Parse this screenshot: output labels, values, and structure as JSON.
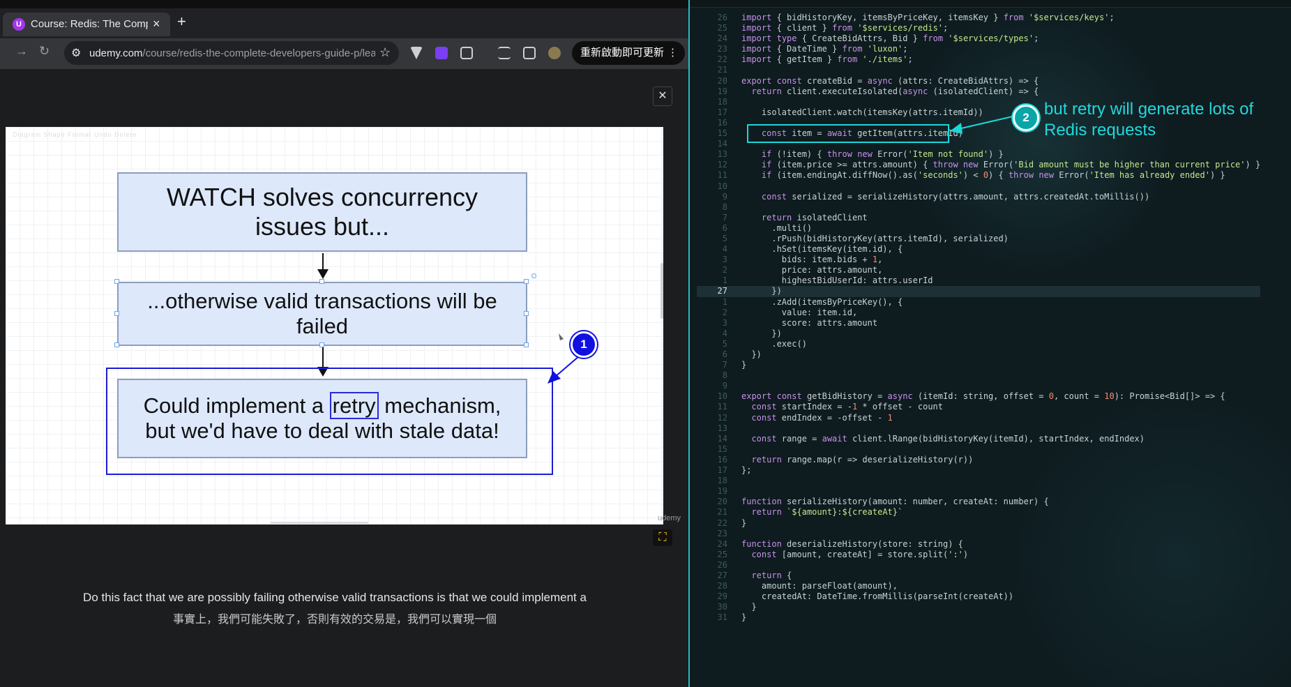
{
  "browser": {
    "tab": {
      "favicon": "U",
      "title": "Course: Redis: The Comp",
      "close": "×"
    },
    "new_tab": "+",
    "nav": {
      "back": "←",
      "forward": "→",
      "reload": "↻"
    },
    "address": {
      "domain": "udemy.com",
      "path": "/course/redis-the-complete-developers-guide-p/lea..."
    },
    "update_button": "重新啟動即可更新",
    "menu": "⋮"
  },
  "player": {
    "close": "✕",
    "watermark": "udemy",
    "fit_icon": "fit-screen-icon"
  },
  "slide": {
    "box1": "WATCH solves concurrency issues but...",
    "box2": "...otherwise valid transactions will be failed",
    "box3_pre": "Could implement a ",
    "box3_word": "retry",
    "box3_post": " mechanism, but we'd have to deal with stale data!",
    "toolbar_faint": "Diagram    Shape  Format    Undo   Delete"
  },
  "annotations": {
    "marker1": "1",
    "marker2": "2",
    "note2": "but retry will generate lots of Redis requests",
    "accent1": "#1010e0",
    "accent2": "#1ad8d8"
  },
  "captions": {
    "english": "Do this fact that we are possibly failing otherwise valid transactions is that we could implement a",
    "chinese": "事實上，我們可能失敗了，否則有效的交易是，我們可以實現一個"
  },
  "editor": {
    "lines": [
      {
        "n": "26",
        "t": "import { bidHistoryKey, itemsByPriceKey, itemsKey } from '$services/keys';"
      },
      {
        "n": "25",
        "t": "import { client } from '$services/redis';"
      },
      {
        "n": "24",
        "t": "import type { CreateBidAttrs, Bid } from '$services/types';"
      },
      {
        "n": "23",
        "t": "import { DateTime } from 'luxon';"
      },
      {
        "n": "22",
        "t": "import { getItem } from './items';"
      },
      {
        "n": "21",
        "t": ""
      },
      {
        "n": "20",
        "t": "export const createBid = async (attrs: CreateBidAttrs) => {"
      },
      {
        "n": "19",
        "t": "  return client.executeIsolated(async (isolatedClient) => {"
      },
      {
        "n": "18",
        "t": ""
      },
      {
        "n": "17",
        "t": "    isolatedClient.watch(itemsKey(attrs.itemId))"
      },
      {
        "n": "16",
        "t": ""
      },
      {
        "n": "15",
        "t": "    const item = await getItem(attrs.itemId)"
      },
      {
        "n": "14",
        "t": ""
      },
      {
        "n": "13",
        "t": "    if (!item) { throw new Error('Item not found') }"
      },
      {
        "n": "12",
        "t": "    if (item.price >= attrs.amount) { throw new Error('Bid amount must be higher than current price') }"
      },
      {
        "n": "11",
        "t": "    if (item.endingAt.diffNow().as('seconds') < 0) { throw new Error('Item has already ended') }"
      },
      {
        "n": "10",
        "t": ""
      },
      {
        "n": "9",
        "t": "    const serialized = serializeHistory(attrs.amount, attrs.createdAt.toMillis())"
      },
      {
        "n": "8",
        "t": ""
      },
      {
        "n": "7",
        "t": "    return isolatedClient"
      },
      {
        "n": "6",
        "t": "      .multi()"
      },
      {
        "n": "5",
        "t": "      .rPush(bidHistoryKey(attrs.itemId), serialized)"
      },
      {
        "n": "4",
        "t": "      .hSet(itemsKey(item.id), {"
      },
      {
        "n": "3",
        "t": "        bids: item.bids + 1,"
      },
      {
        "n": "2",
        "t": "        price: attrs.amount,"
      },
      {
        "n": "1",
        "t": "        highestBidUserId: attrs.userId"
      },
      {
        "n": "27",
        "t": "      })",
        "cur": true
      },
      {
        "n": "1",
        "t": "      .zAdd(itemsByPriceKey(), {"
      },
      {
        "n": "2",
        "t": "        value: item.id,"
      },
      {
        "n": "3",
        "t": "        score: attrs.amount"
      },
      {
        "n": "4",
        "t": "      })"
      },
      {
        "n": "5",
        "t": "      .exec()"
      },
      {
        "n": "6",
        "t": "  })"
      },
      {
        "n": "7",
        "t": "}"
      },
      {
        "n": "8",
        "t": ""
      },
      {
        "n": "9",
        "t": ""
      },
      {
        "n": "10",
        "t": "export const getBidHistory = async (itemId: string, offset = 0, count = 10): Promise<Bid[]> => {"
      },
      {
        "n": "11",
        "t": "  const startIndex = -1 * offset - count"
      },
      {
        "n": "12",
        "t": "  const endIndex = -offset - 1"
      },
      {
        "n": "13",
        "t": ""
      },
      {
        "n": "14",
        "t": "  const range = await client.lRange(bidHistoryKey(itemId), startIndex, endIndex)"
      },
      {
        "n": "15",
        "t": ""
      },
      {
        "n": "16",
        "t": "  return range.map(r => deserializeHistory(r))"
      },
      {
        "n": "17",
        "t": "};"
      },
      {
        "n": "18",
        "t": ""
      },
      {
        "n": "19",
        "t": ""
      },
      {
        "n": "20",
        "t": "function serializeHistory(amount: number, createAt: number) {"
      },
      {
        "n": "21",
        "t": "  return `${amount}:${createAt}`"
      },
      {
        "n": "22",
        "t": "}"
      },
      {
        "n": "23",
        "t": ""
      },
      {
        "n": "24",
        "t": "function deserializeHistory(store: string) {"
      },
      {
        "n": "25",
        "t": "  const [amount, createAt] = store.split(':')"
      },
      {
        "n": "26",
        "t": ""
      },
      {
        "n": "27",
        "t": "  return {"
      },
      {
        "n": "28",
        "t": "    amount: parseFloat(amount),"
      },
      {
        "n": "29",
        "t": "    createdAt: DateTime.fromMillis(parseInt(createAt))"
      },
      {
        "n": "30",
        "t": "  }"
      },
      {
        "n": "31",
        "t": "}"
      }
    ]
  }
}
